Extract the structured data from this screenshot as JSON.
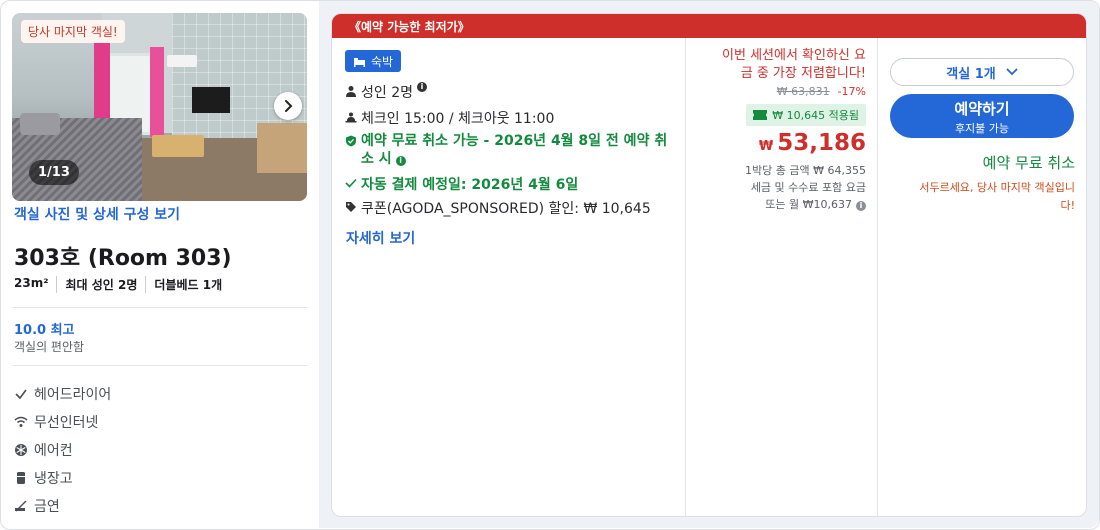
{
  "room": {
    "last_room_badge": "당사 마지막 객실!",
    "photo_counter": "1/13",
    "view_photos_link": "객실 사진 및 상세 구성 보기",
    "name": "303호 (Room 303)",
    "specs": [
      "23m²",
      "최대 성인 2명",
      "더블베드 1개"
    ],
    "score_title": "10.0 최고",
    "score_subtitle": "객실의 편안함",
    "amenities": [
      {
        "label": "헤어드라이어",
        "icon": "checkmark-icon"
      },
      {
        "label": "무선인터넷",
        "icon": "wifi-icon"
      },
      {
        "label": "에어컨",
        "icon": "snowflake-icon"
      },
      {
        "label": "냉장고",
        "icon": "fridge-icon"
      },
      {
        "label": "금연",
        "icon": "no-smoking-icon"
      }
    ]
  },
  "offer": {
    "header": "《예약 가능한 최저가》",
    "stay_tag": "숙박",
    "features": {
      "guests": "성인 2명",
      "checkin": "체크인 15:00 / 체크아웃 11:00",
      "free_cancel_line1": "예약 무료 취소 가능 - 2026년 4월 8일 전 예약 취",
      "free_cancel_line2": "소 시",
      "auto_pay": "자동 결제 예정일: 2026년 4월 6일",
      "coupon": "쿠폰(AGODA_SPONSORED) 할인: ₩ 10,645"
    },
    "more_link": "자세히 보기",
    "colors": {
      "accent": "#2467d6",
      "red": "#cf2f2a",
      "green": "#138a3e"
    }
  },
  "price": {
    "best_price_line1": "이번 세션에서 확인하신 요",
    "best_price_line2": "금 중 가장 저렴합니다!",
    "original": "₩ 63,831",
    "discount": "-17%",
    "coupon_applied": "₩ 10,645 적용됨",
    "currency": "₩",
    "amount": "53,186",
    "per_night_total": "1박당 총 금액 ₩ 64,355",
    "tax_line": "세금 및 수수료 포함 요금",
    "monthly": "또는 월 ₩10,637"
  },
  "booking": {
    "room_select": "객실 1개",
    "book_button": "예약하기",
    "book_sub": "후지불 가능",
    "free_cancel": "예약 무료 취소",
    "hurry_line1": "서두르세요, 당사 마지막 객실입니",
    "hurry_line2": "다!"
  }
}
